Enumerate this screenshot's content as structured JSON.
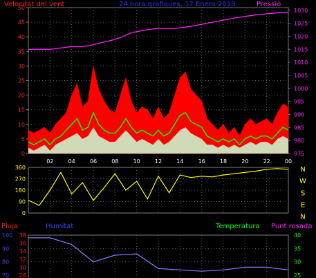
{
  "top": {
    "title_left": "Velocitat del vent",
    "title_center": "24 hora gràfiques, 17 Enero 2018",
    "title_right": "Pressió",
    "colors": {
      "left": "#ff2020",
      "center": "#3030ff",
      "right": "#ff20ff"
    }
  },
  "mid": {
    "dir_labels": [
      "N",
      "W",
      "S",
      "E",
      "N"
    ],
    "dir_color": "#ffff00"
  },
  "bottom": {
    "labels": {
      "pluja": "Pluja",
      "humitat": "Humitat",
      "temperatura": "Temperatura",
      "punt_rosada": "Punt rosada"
    },
    "colors": {
      "pluja": "#ff2020",
      "humitat": "#4040ff",
      "temperatura": "#00ff00",
      "punt_rosada": "#ff20ff"
    }
  },
  "chart_data": [
    {
      "type": "line",
      "title": "24 hora gràfiques, 17 Enero 2018",
      "x_ticks": [
        "02",
        "04",
        "06",
        "08",
        "10",
        "12",
        "14",
        "16",
        "18",
        "20",
        "22",
        "00"
      ],
      "left_axis": {
        "label": "Velocitat del vent",
        "range": [
          0,
          50
        ],
        "ticks": [
          0,
          5,
          10,
          15,
          20,
          25,
          30,
          35,
          40,
          45,
          50
        ]
      },
      "right_axis": {
        "label": "Pressió",
        "range": [
          975,
          1031
        ],
        "ticks": [
          975,
          980,
          985,
          990,
          995,
          1000,
          1005,
          1010,
          1015,
          1020,
          1025,
          1030
        ]
      },
      "x": [
        0,
        0.5,
        1,
        1.5,
        2,
        2.5,
        3,
        3.5,
        4,
        4.5,
        5,
        5.5,
        6,
        6.5,
        7,
        7.5,
        8,
        8.5,
        9,
        9.5,
        10,
        10.5,
        11,
        11.5,
        12,
        12.5,
        13,
        13.5,
        14,
        14.5,
        15,
        15.5,
        16,
        16.5,
        17,
        17.5,
        18,
        18.5,
        19,
        19.5,
        20,
        20.5,
        21,
        21.5,
        22,
        22.5,
        23,
        23.5,
        24
      ],
      "series": [
        {
          "name": "gust",
          "color": "#ff0000",
          "values": [
            8,
            7,
            8,
            9,
            7,
            10,
            12,
            14,
            20,
            24,
            16,
            18,
            30,
            22,
            18,
            15,
            14,
            20,
            26,
            18,
            14,
            16,
            15,
            12,
            16,
            12,
            14,
            20,
            26,
            28,
            22,
            20,
            18,
            12,
            10,
            8,
            10,
            7,
            9,
            6,
            10,
            12,
            10,
            11,
            12,
            10,
            14,
            17,
            16
          ]
        },
        {
          "name": "average",
          "color": "#00ff00",
          "values": [
            4,
            3,
            4,
            5,
            3,
            5,
            6,
            8,
            10,
            12,
            8,
            9,
            14,
            10,
            8,
            7,
            7,
            9,
            12,
            9,
            7,
            8,
            7,
            6,
            8,
            6,
            7,
            10,
            13,
            14,
            11,
            10,
            9,
            6,
            5,
            4,
            5,
            4,
            5,
            3,
            5,
            6,
            5,
            6,
            6,
            5,
            7,
            9,
            8
          ]
        },
        {
          "name": "minimum",
          "color": "#c8ffd8",
          "values": [
            2,
            1,
            2,
            3,
            1,
            3,
            4,
            5,
            6,
            7,
            5,
            6,
            9,
            6,
            5,
            4,
            4,
            6,
            8,
            6,
            4,
            5,
            4,
            3,
            5,
            3,
            4,
            6,
            8,
            9,
            7,
            6,
            5,
            3,
            3,
            2,
            3,
            2,
            3,
            2,
            3,
            4,
            3,
            4,
            4,
            3,
            5,
            6,
            5
          ]
        },
        {
          "name": "Pressió",
          "color": "#ff20ff",
          "axis": "right",
          "values": [
            1015,
            1015,
            1015,
            1015,
            1015,
            1015.2,
            1015.5,
            1015.8,
            1016,
            1016,
            1016,
            1016.3,
            1016.8,
            1017.3,
            1017.8,
            1018.3,
            1018.8,
            1019.5,
            1020.5,
            1021.3,
            1021.8,
            1022.2,
            1022.5,
            1022.8,
            1023,
            1023,
            1023,
            1023,
            1023.2,
            1023.5,
            1023.8,
            1024.2,
            1024.6,
            1025,
            1025.4,
            1025.8,
            1026.2,
            1026.6,
            1027,
            1027.3,
            1027.6,
            1027.9,
            1028.2,
            1028.4,
            1028.6,
            1028.8,
            1029,
            1029.1,
            1029.3
          ]
        }
      ]
    },
    {
      "type": "line",
      "y_axis": {
        "range": [
          0,
          360
        ],
        "ticks": [
          0,
          90,
          180,
          270,
          360
        ]
      },
      "x": [
        0,
        1,
        2,
        3,
        4,
        5,
        6,
        7,
        8,
        9,
        10,
        11,
        12,
        13,
        14,
        15,
        16,
        17,
        18,
        19,
        20,
        21,
        22,
        23,
        24
      ],
      "series": [
        {
          "name": "direction",
          "color": "#ffff00",
          "values": [
            100,
            60,
            180,
            320,
            150,
            240,
            100,
            200,
            310,
            180,
            250,
            110,
            290,
            160,
            300,
            280,
            290,
            285,
            300,
            310,
            320,
            330,
            345,
            350,
            345
          ]
        }
      ]
    },
    {
      "type": "line",
      "axes": {
        "humitat": {
          "range": [
            70,
            100
          ],
          "ticks": [
            70,
            80,
            90,
            100
          ]
        },
        "pluja": {
          "range": [
            28,
            38
          ],
          "ticks": [
            28,
            30,
            32,
            34,
            36,
            38
          ]
        },
        "temperatura": {
          "range": [
            25,
            40
          ],
          "ticks": [
            25,
            30,
            35,
            40
          ]
        }
      },
      "x": [
        0,
        2,
        4,
        6,
        8,
        10,
        12,
        14,
        16,
        18,
        20,
        22,
        24
      ],
      "series": [
        {
          "name": "Humitat",
          "color": "#8080ff",
          "values": [
            98,
            98,
            93,
            80,
            85,
            86,
            75,
            74,
            73,
            74,
            76,
            76,
            74
          ]
        }
      ]
    }
  ]
}
